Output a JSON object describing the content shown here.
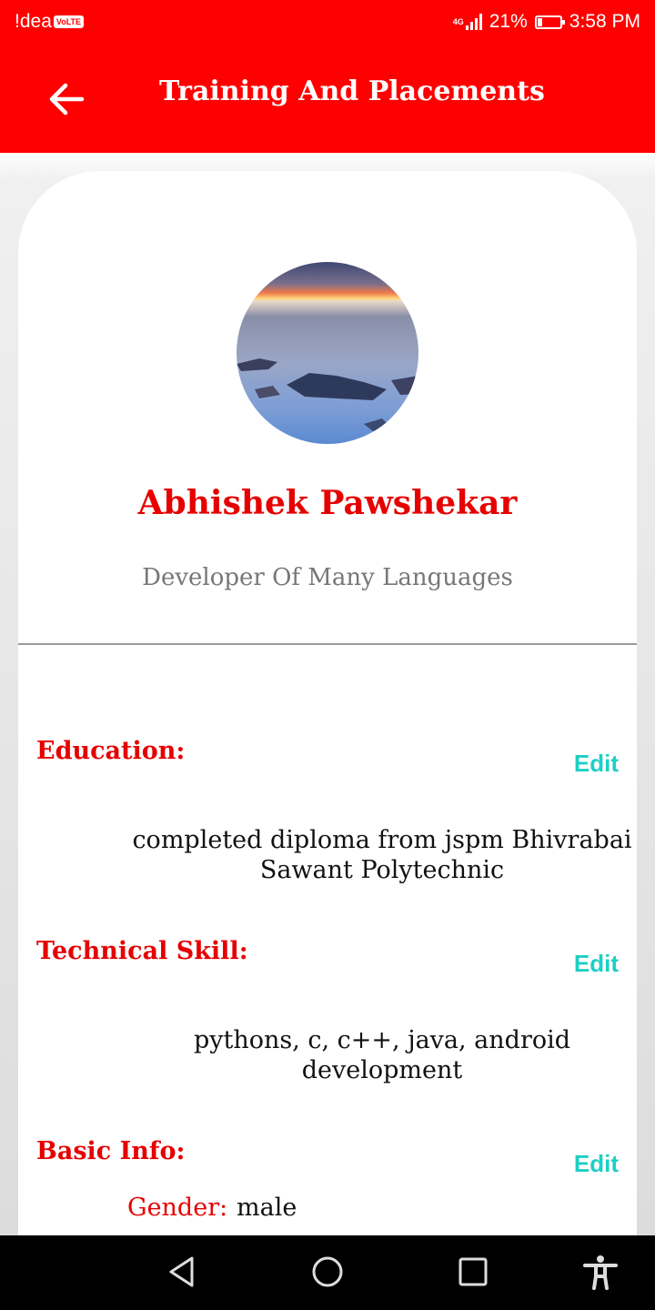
{
  "status_bar": {
    "carrier": "!dea",
    "volte": "VoLTE",
    "network": "4G",
    "battery": "21%",
    "battery_level": 0.21,
    "time": "3:58 PM"
  },
  "app_bar": {
    "title": "Training And Placements",
    "back_icon": "arrow-left-icon"
  },
  "profile": {
    "name": "Abhishek Pawshekar",
    "subtitle": "Developer Of Many Languages"
  },
  "sections": {
    "education": {
      "title": "Education:",
      "edit": "Edit",
      "text_line1": "completed diploma from jspm Bhivrabai",
      "text_line2": "Sawant Polytechnic"
    },
    "technical_skill": {
      "title": "Technical Skill:",
      "edit": "Edit",
      "text_line1": "pythons, c, c++, java, android",
      "text_line2": "development"
    },
    "basic_info": {
      "title": "Basic Info:",
      "edit": "Edit",
      "gender_label": "Gender:",
      "gender_value": "male"
    }
  },
  "colors": {
    "primary": "#ff0000",
    "accent_text": "#e60000",
    "edit": "#1ccfc4"
  },
  "nav_bar": {
    "icons": [
      "back-triangle-icon",
      "home-circle-icon",
      "recents-square-icon",
      "accessibility-icon"
    ]
  }
}
